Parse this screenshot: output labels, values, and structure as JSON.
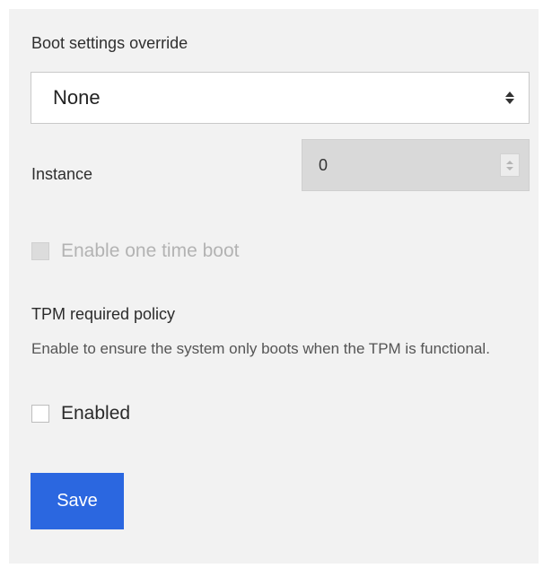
{
  "boot": {
    "label": "Boot settings override",
    "selected_value": "None"
  },
  "instance": {
    "label": "Instance",
    "value": "0",
    "disabled": true
  },
  "one_time_boot": {
    "label": "Enable one time boot",
    "checked": false,
    "disabled": true
  },
  "tpm": {
    "title": "TPM required policy",
    "description": "Enable to ensure the system only boots when the TPM is functional.",
    "checkbox_label": "Enabled",
    "checked": false
  },
  "actions": {
    "save_label": "Save"
  },
  "colors": {
    "panel_background": "#f2f2f2",
    "primary_button": "#2b67e0",
    "disabled_field": "#d9d9d9"
  },
  "icons": {
    "select": "select-arrows-icon",
    "spinner": "spinner-icon",
    "checkbox": "checkbox-icon"
  }
}
